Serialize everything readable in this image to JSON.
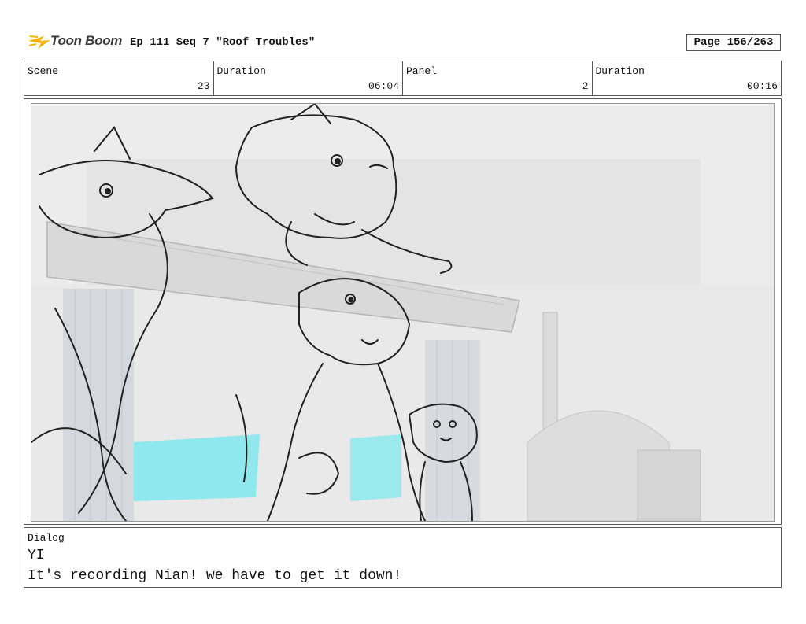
{
  "header": {
    "logo_text": "Toon Boom",
    "title": "Ep 111 Seq 7 \"Roof Troubles\"",
    "page": "Page 156/263"
  },
  "info": {
    "scene_label": "Scene",
    "scene_value": "23",
    "duration_label": "Duration",
    "duration_value": "06:04",
    "panel_label": "Panel",
    "panel_value": "2",
    "panel_duration_label": "Duration",
    "panel_duration_value": "00:16"
  },
  "panel_image": {
    "icon": "storyboard-sketch-image",
    "colors": {
      "background": "#ececec",
      "accent": "#7fe8ee",
      "line": "#222222"
    }
  },
  "dialog": {
    "label": "Dialog",
    "speaker": "YI",
    "line": "It's recording Nian! we have to get it down!"
  }
}
